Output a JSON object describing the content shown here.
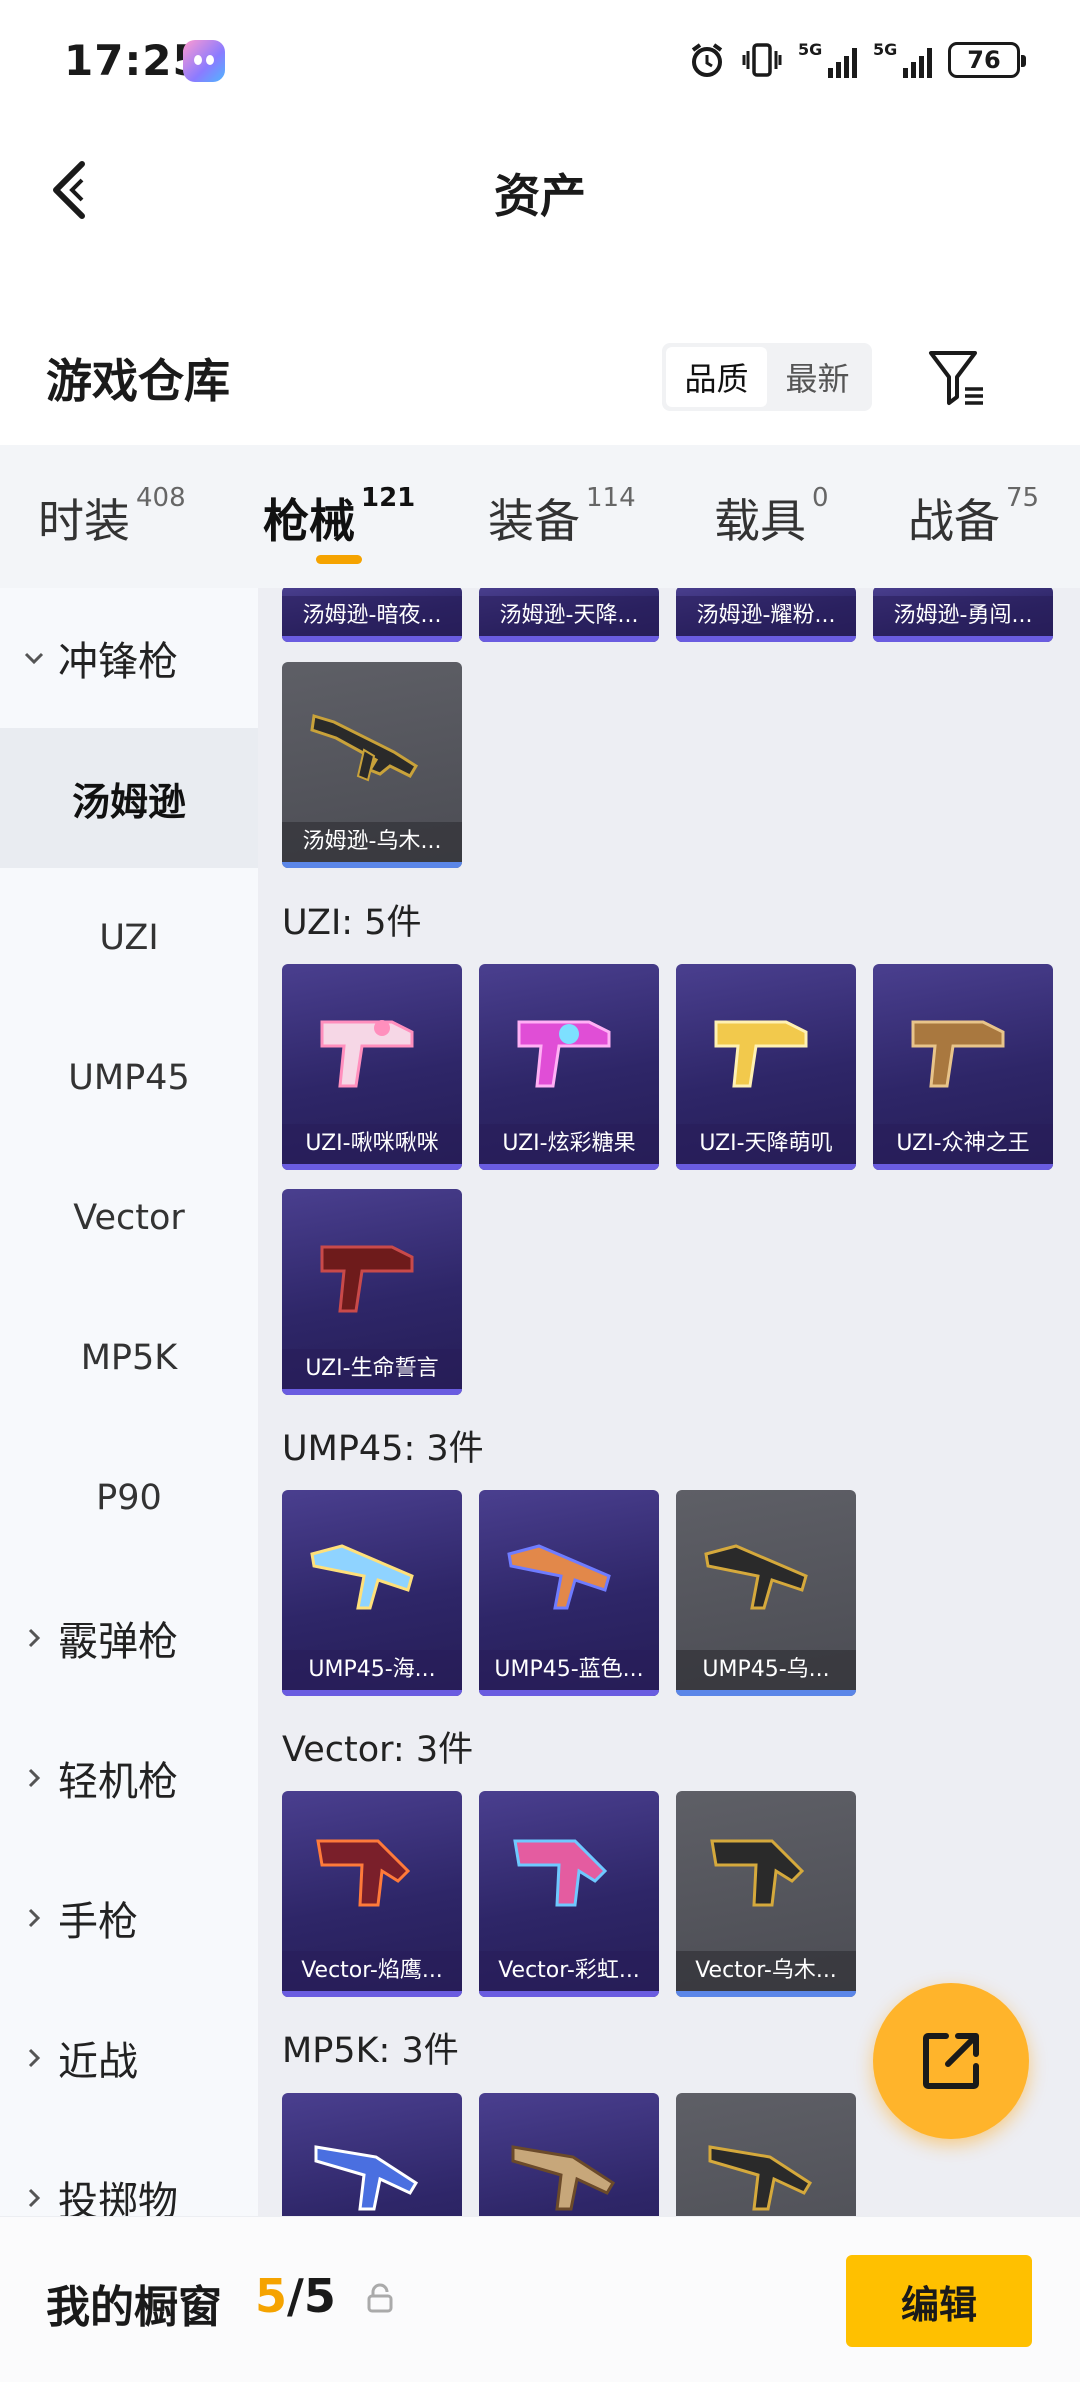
{
  "status_bar": {
    "time": "17:25",
    "net1": "5G",
    "net2": "5G",
    "battery": "76"
  },
  "header": {
    "title": "资产"
  },
  "warehouse": {
    "title": "游戏仓库",
    "sort_options": [
      "品质",
      "最新"
    ],
    "active_sort": "品质"
  },
  "tabs": [
    {
      "label": "时装",
      "count": "408"
    },
    {
      "label": "枪械",
      "count": "121"
    },
    {
      "label": "装备",
      "count": "114"
    },
    {
      "label": "载具",
      "count": "0"
    },
    {
      "label": "战备",
      "count": "75"
    }
  ],
  "active_tab": "枪械",
  "sidebar": {
    "groups": [
      {
        "label": "冲锋枪",
        "expanded": true,
        "children": [
          "汤姆逊",
          "UZI",
          "UMP45",
          "Vector",
          "MP5K",
          "P90"
        ]
      },
      {
        "label": "霰弹枪"
      },
      {
        "label": "轻机枪"
      },
      {
        "label": "手枪"
      },
      {
        "label": "近战"
      },
      {
        "label": "投掷物"
      }
    ],
    "selected": "汤姆逊"
  },
  "content": {
    "thompson_strip": [
      "汤姆逊-暗夜...",
      "汤姆逊-天降...",
      "汤姆逊-耀粉...",
      "汤姆逊-勇闯..."
    ],
    "thompson_extra": "汤姆逊-乌木...",
    "uzi": {
      "label": "UZI: 5件",
      "items": [
        "UZI-啾咪啾咪",
        "UZI-炫彩糖果",
        "UZI-天降萌叽",
        "UZI-众神之王",
        "UZI-生命誓言"
      ]
    },
    "ump45": {
      "label": "UMP45: 3件",
      "items": [
        "UMP45-海...",
        "UMP45-蓝色...",
        "UMP45-乌..."
      ]
    },
    "vector": {
      "label": "Vector: 3件",
      "items": [
        "Vector-焰鹰...",
        "Vector-彩虹...",
        "Vector-乌木..."
      ]
    },
    "mp5k": {
      "label": "MP5K: 3件"
    }
  },
  "bottom_bar": {
    "label": "我的橱窗",
    "current": "5",
    "sep": "/",
    "total": "5",
    "edit": "编辑"
  },
  "colors": {
    "accent": "#f5a300",
    "button": "#ffc000",
    "fab": "#ffb42b",
    "card_purple": "#2e2668",
    "card_grey": "#4b4c53"
  }
}
